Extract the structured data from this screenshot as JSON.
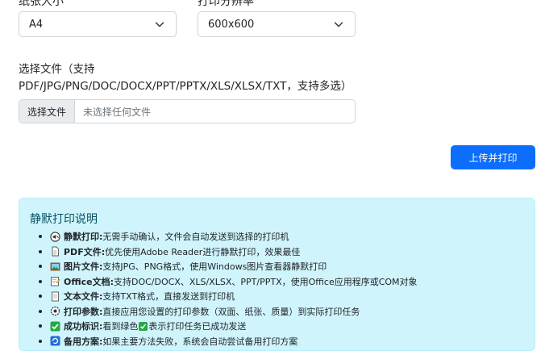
{
  "top": {
    "paper_label": "纸张大小",
    "resolution_label": "打印分辨率",
    "paper_value": "A4",
    "resolution_value": "600x600"
  },
  "file": {
    "label_line1": "选择文件（支持",
    "label_line2": "PDF/JPG/PNG/DOC/DOCX/PPT/PPTX/XLS/XLSX/TXT，支持多选）",
    "button": "选择文件",
    "placeholder": "未选择任何文件"
  },
  "upload_button": "上传并打印",
  "info": {
    "title": "静默打印说明",
    "items": [
      {
        "icon": "mute-icon",
        "bold": "静默打印:",
        "text": " 无需手动确认，文件会自动发送到选择的打印机"
      },
      {
        "icon": "document-icon",
        "bold": "PDF文件:",
        "text": " 优先使用Adobe Reader进行静默打印，效果最佳"
      },
      {
        "icon": "picture-icon",
        "bold": "图片文件:",
        "text": " 支持JPG、PNG格式，使用Windows图片查看器静默打印"
      },
      {
        "icon": "memo-icon",
        "bold": "Office文档:",
        "text": " 支持DOC/DOCX、XLS/XLSX、PPT/PPTX，使用Office应用程序或COM对象"
      },
      {
        "icon": "page-icon",
        "bold": "文本文件:",
        "text": " 支持TXT格式，直接发送到打印机"
      },
      {
        "icon": "gear-icon",
        "bold": "打印参数:",
        "text": " 直接应用您设置的打印参数（双面、纸张、质量）到实际打印任务"
      },
      {
        "icon": "check-icon",
        "bold": "成功标识:",
        "text_a": " 看到绿色",
        "text_b": "表示打印任务已成功发送"
      },
      {
        "icon": "backup-icon",
        "bold": "备用方案:",
        "text": " 如果主要方法失败，系统会自动尝试备用打印方案"
      }
    ]
  },
  "colors": {
    "primary": "#0d6efd",
    "info_bg": "#cff4fc",
    "info_title": "#055160"
  }
}
